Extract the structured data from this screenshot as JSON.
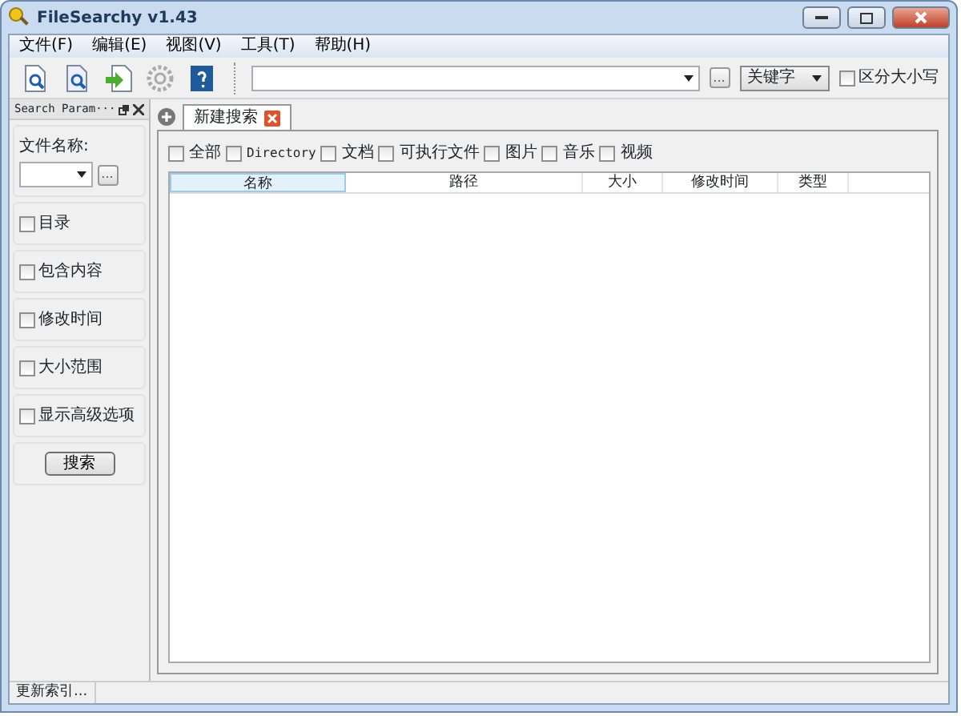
{
  "window": {
    "title": "FileSearchy v1.43"
  },
  "menu": [
    "文件(F)",
    "编辑(E)",
    "视图(V)",
    "工具(T)",
    "帮助(H)"
  ],
  "search_bar": {
    "browse": "...",
    "mode": "关键字",
    "case_sensitive": {
      "label": "区分大小写",
      "checked": false
    }
  },
  "panel": {
    "title": "Search Param···",
    "filename_label": "文件名称:",
    "browse": "...",
    "options": [
      {
        "label": "目录",
        "checked": false
      },
      {
        "label": "包含内容",
        "checked": false
      },
      {
        "label": "修改时间",
        "checked": false
      },
      {
        "label": "大小范围",
        "checked": false
      },
      {
        "label": "显示高级选项",
        "checked": false
      }
    ],
    "search_button": "搜索"
  },
  "tabs": [
    {
      "label": "新建搜索",
      "selected": true
    }
  ],
  "filters": [
    {
      "label": "全部",
      "checked": false
    },
    {
      "label": "Directory",
      "checked": false
    },
    {
      "label": "文档",
      "checked": false
    },
    {
      "label": "可执行文件",
      "checked": false
    },
    {
      "label": "图片",
      "checked": false
    },
    {
      "label": "音乐",
      "checked": false
    },
    {
      "label": "视频",
      "checked": false
    }
  ],
  "table": {
    "columns": [
      {
        "label": "名称",
        "sorted": true
      },
      {
        "label": "路径",
        "sorted": false
      },
      {
        "label": "大小",
        "sorted": false
      },
      {
        "label": "修改时间",
        "sorted": false
      },
      {
        "label": "类型",
        "sorted": false
      }
    ]
  },
  "status_bar": "更新索引..."
}
